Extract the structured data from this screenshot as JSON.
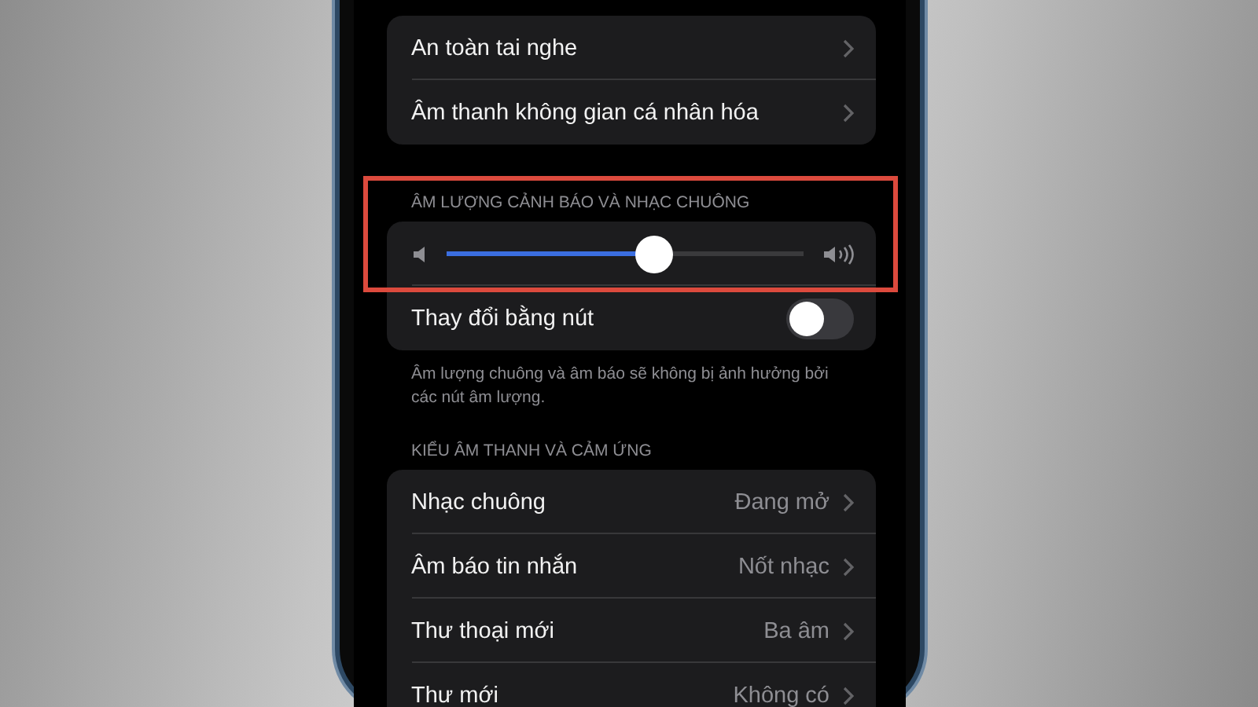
{
  "headphone_group": {
    "rows": [
      {
        "label": "An toàn tai nghe"
      },
      {
        "label": "Âm thanh không gian cá nhân hóa"
      }
    ]
  },
  "volume_section": {
    "header": "ÂM LƯỢNG CẢNH BÁO VÀ NHẠC CHUÔNG",
    "highlighted": true,
    "slider": {
      "level": 0.585
    },
    "toggle": {
      "label": "Thay đổi bằng nút",
      "on": false
    },
    "footer": "Âm lượng chuông và âm báo sẽ không bị ảnh hưởng bởi các nút âm lượng."
  },
  "sounds_section": {
    "header": "KIỂU ÂM THANH VÀ CẢM ỨNG",
    "rows": [
      {
        "label": "Nhạc chuông",
        "value": "Đang mở"
      },
      {
        "label": "Âm báo tin nhắn",
        "value": "Nốt nhạc"
      },
      {
        "label": "Thư thoại mới",
        "value": "Ba âm"
      },
      {
        "label": "Thư mới",
        "value": "Không có"
      }
    ]
  }
}
